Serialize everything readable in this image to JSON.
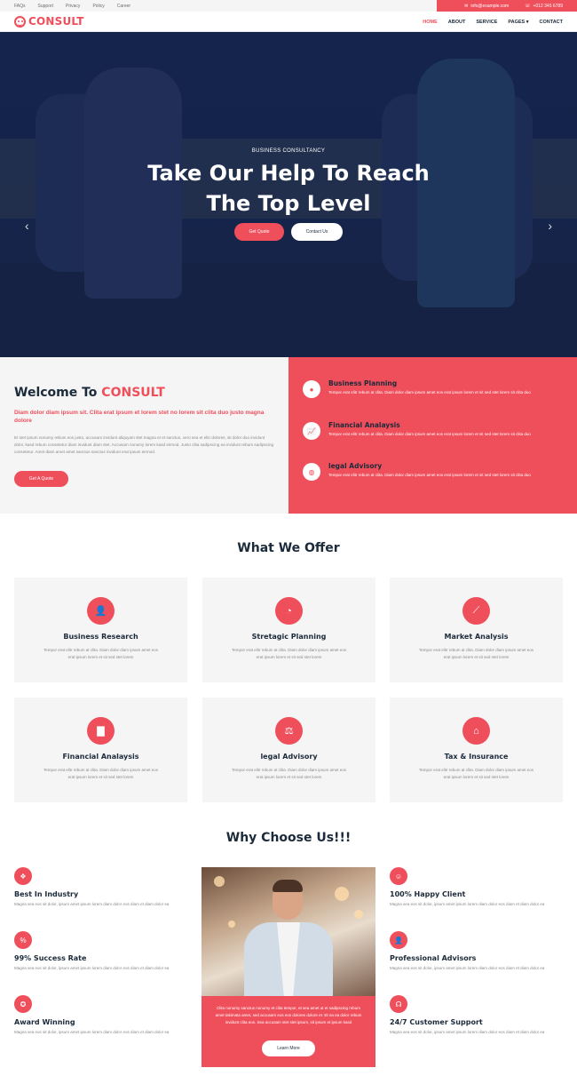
{
  "topbar": {
    "links": [
      "FAQs",
      "Support",
      "Privacy",
      "Policy",
      "Career"
    ],
    "email": "info@example.com",
    "phone": "+012 345 6789"
  },
  "brand": {
    "name": "CONSULT"
  },
  "nav": {
    "items": [
      "HOME",
      "ABOUT",
      "SERVICE",
      "PAGES ▾",
      "CONTACT"
    ],
    "active": "HOME"
  },
  "hero": {
    "eyebrow": "BUSINESS CONSULTANCY",
    "title_line1": "Take Our Help To Reach",
    "title_line2": "The Top Level",
    "btn_primary": "Get Quote",
    "btn_secondary": "Contact Us"
  },
  "welcome": {
    "title_prefix": "Welcome To ",
    "title_accent": "CONSULT",
    "subtitle": "Diam dolor diam ipsum sit. Clita erat ipsum et lorem stet no lorem sit clita duo justo magna dolore",
    "paragraph": "Et stet ipsum nonumy rebum eos justo, accusam invidunt aliquyam stet magna et et sanctus, vero sea et elitr dolores, sit dolor duo invidunt dolor, kasd rebum consetetur diam invidunt diam stet. Accusam nonumy lorem kasd eirmod. Justo clita sadipscing ea invidunt rebum sadipscing consetetur. Amet diam amet amet sanctus sanctus invidunt erat ipsum eirmod.",
    "button": "Get A Quote"
  },
  "feature_services": [
    {
      "title": "Business Planning",
      "desc": "Tempor erat elitr rebum at clita. Diam dolor diam ipsum amet eos erat ipsum lorem et sit sed stet lorem sit clita duo"
    },
    {
      "title": "Financial Analaysis",
      "desc": "Tempor erat elitr rebum at clita. Diam dolor diam ipsum amet eos erat ipsum lorem et sit sed stet lorem sit clita duo"
    },
    {
      "title": "legal Advisory",
      "desc": "Tempor erat elitr rebum at clita. Diam dolor diam ipsum amet eos erat ipsum lorem et sit sed stet lorem sit clita duo"
    }
  ],
  "offer": {
    "title": "What We Offer",
    "cards": [
      {
        "title": "Business Research",
        "icon": "user-tie-icon",
        "desc": "Tempor erat elitr rebum at clita. Diam dolor diam ipsum amet eos erat ipsum lorem et sit sed stet lorem"
      },
      {
        "title": "Stretagic Planning",
        "icon": "pie-chart-icon",
        "desc": "Tempor erat elitr rebum at clita. Diam dolor diam ipsum amet eos erat ipsum lorem et sit sed stet lorem"
      },
      {
        "title": "Market Analysis",
        "icon": "line-chart-icon",
        "desc": "Tempor erat elitr rebum at clita. Diam dolor diam ipsum amet eos erat ipsum lorem et sit sed stet lorem"
      },
      {
        "title": "Financial Analaysis",
        "icon": "bar-chart-icon",
        "desc": "Tempor erat elitr rebum at clita. Diam dolor diam ipsum amet eos erat ipsum lorem et sit sed stet lorem"
      },
      {
        "title": "legal Advisory",
        "icon": "balance-scale-icon",
        "desc": "Tempor erat elitr rebum at clita. Diam dolor diam ipsum amet eos erat ipsum lorem et sit sed stet lorem"
      },
      {
        "title": "Tax & Insurance",
        "icon": "house-icon",
        "desc": "Tempor erat elitr rebum at clita. Diam dolor diam ipsum amet eos erat ipsum lorem et sit sed stet lorem"
      }
    ]
  },
  "why": {
    "title": "Why Choose Us!!!",
    "left": [
      {
        "title": "Best In Industry",
        "icon": "cubes-icon",
        "desc": "Magna sea eos sit dolor, ipsum amet ipsum lorem diam dolor eos diam et diam dolor ea"
      },
      {
        "title": "99% Success Rate",
        "icon": "percent-icon",
        "desc": "Magna sea eos sit dolor, ipsum amet ipsum lorem diam dolor eos diam et diam dolor ea"
      },
      {
        "title": "Award Winning",
        "icon": "award-icon",
        "desc": "Magna sea eos sit dolor, ipsum amet ipsum lorem diam dolor eos diam et diam dolor ea"
      }
    ],
    "right": [
      {
        "title": "100% Happy Client",
        "icon": "smile-icon",
        "desc": "Magna sea eos sit dolor, ipsum amet ipsum lorem diam dolor eos diam et diam dolor ea"
      },
      {
        "title": "Professional Advisors",
        "icon": "user-tie-icon",
        "desc": "Magna sea eos sit dolor, ipsum amet ipsum lorem diam dolor eos diam et diam dolor ea"
      },
      {
        "title": "24/7 Customer Support",
        "icon": "headset-icon",
        "desc": "Magna sea eos sit dolor, ipsum amet ipsum lorem diam dolor eos diam et diam dolor ea"
      }
    ],
    "card_text": "Clita nonumy sanctus nonumy et clita tempor, et sea amet ut et sadipscing rebum amet takimata amet, sed accusam eos eos dolores dolore et. Et ea ea dolor rebum invidunt clita eos. Sea accusam stet stet ipsum, sit ipsum et ipsum kasd",
    "card_button": "Learn More"
  },
  "colors": {
    "accent": "#ef4e5b",
    "dark": "#1b2a3a",
    "light_bg": "#f5f5f5"
  }
}
